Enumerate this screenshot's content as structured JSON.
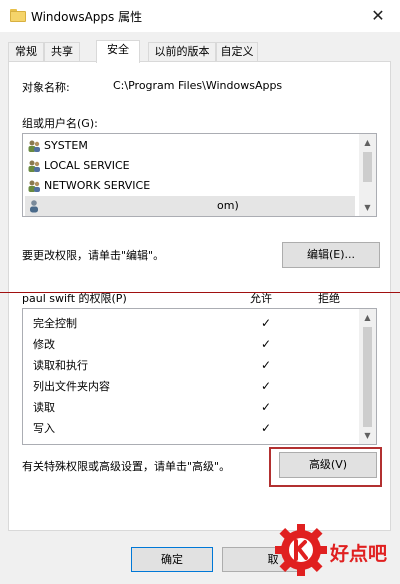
{
  "window": {
    "title": "WindowsApps 属性",
    "close_icon": "close-icon"
  },
  "tabs": [
    {
      "label": "常规"
    },
    {
      "label": "共享"
    },
    {
      "label": "安全"
    },
    {
      "label": "以前的版本"
    },
    {
      "label": "自定义"
    }
  ],
  "active_tab": "安全",
  "object": {
    "label": "对象名称:",
    "value": "C:\\Program Files\\WindowsApps"
  },
  "groups": {
    "label": "组或用户名(G):",
    "items": [
      {
        "name": "SYSTEM",
        "icon": "user-group-icon"
      },
      {
        "name": "LOCAL SERVICE",
        "icon": "user-group-icon"
      },
      {
        "name": "NETWORK SERVICE",
        "icon": "user-group-icon"
      },
      {
        "name": "om)",
        "icon": "user-icon"
      }
    ]
  },
  "edit": {
    "hint": "要更改权限，请单击\"编辑\"。",
    "button_label": "编辑(E)..."
  },
  "permissions": {
    "label": "paul swift 的权限(P)",
    "allow_header": "允许",
    "deny_header": "拒绝",
    "rows": [
      {
        "name": "完全控制",
        "allow": "✓",
        "deny": ""
      },
      {
        "name": "修改",
        "allow": "✓",
        "deny": ""
      },
      {
        "name": "读取和执行",
        "allow": "✓",
        "deny": ""
      },
      {
        "name": "列出文件夹内容",
        "allow": "✓",
        "deny": ""
      },
      {
        "name": "读取",
        "allow": "✓",
        "deny": ""
      },
      {
        "name": "写入",
        "allow": "✓",
        "deny": ""
      }
    ]
  },
  "advanced": {
    "hint": "有关特殊权限或高级设置，请单击\"高级\"。",
    "button_label": "高级(V)"
  },
  "footer": {
    "ok_label": "确定",
    "cancel_label": "取"
  },
  "watermark": {
    "text": "好点吧"
  },
  "colors": {
    "highlight_red": "#b23030",
    "brand_red": "#e02020"
  }
}
